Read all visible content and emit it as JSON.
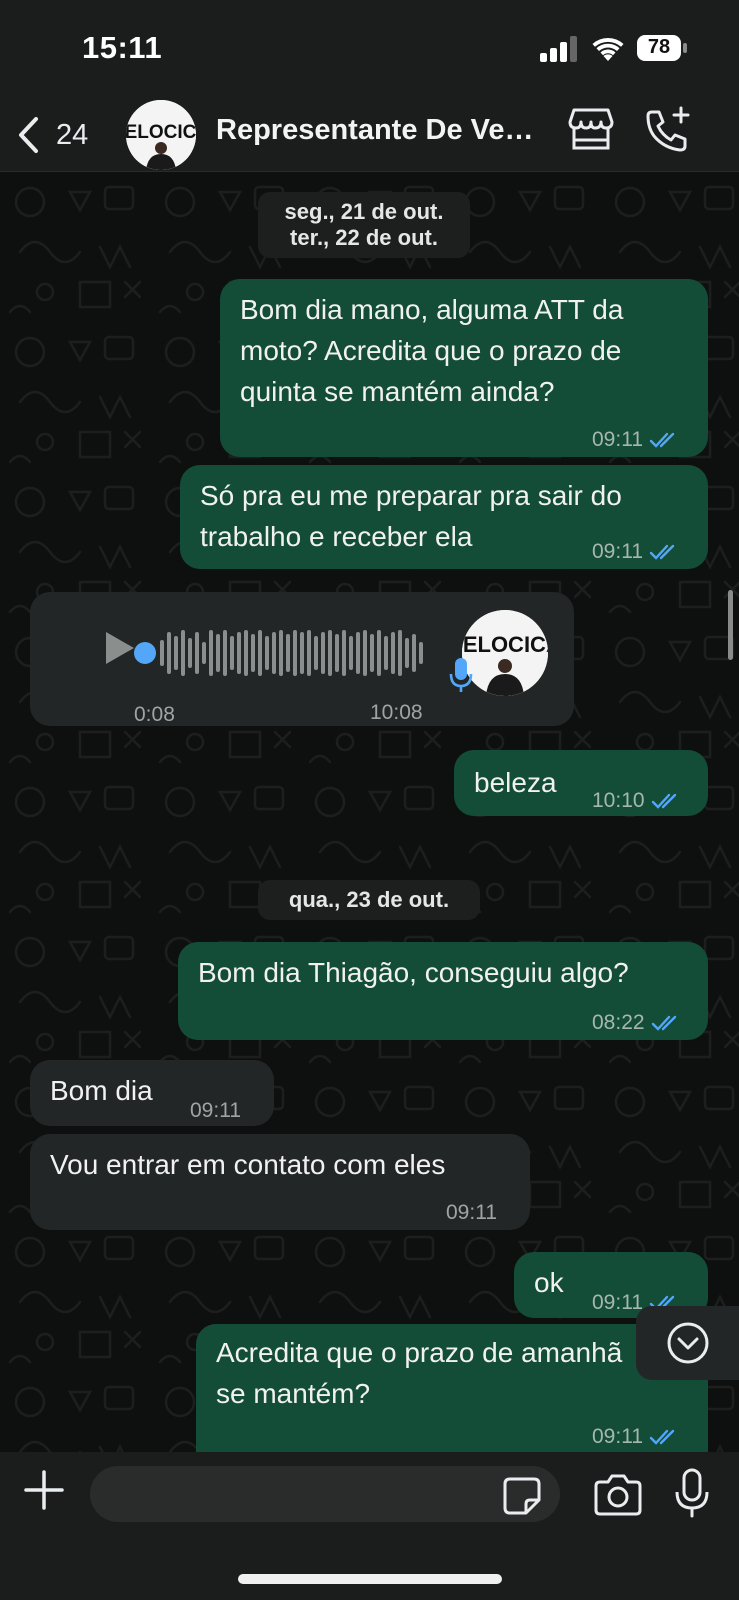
{
  "status_bar": {
    "time": "15:11",
    "battery": "78"
  },
  "header": {
    "back_count": "24",
    "contact_name": "Representante De Vendas - Velocicar",
    "avatar_text": "VELOCICA"
  },
  "dates": {
    "d1": "seg., 21 de out.",
    "d2": "ter., 22 de out.",
    "d3": "qua., 23 de out."
  },
  "messages": [
    {
      "dir": "out",
      "lines": [
        "Bom dia mano, alguma ATT da",
        "moto? Acredita que o prazo de",
        "quinta se mantém ainda?"
      ],
      "time": "09:11",
      "read": true
    },
    {
      "dir": "out",
      "lines": [
        "Só pra eu me preparar pra sair do",
        "trabalho e receber ela"
      ],
      "time": "09:11",
      "read": true
    },
    {
      "dir": "in",
      "type": "voice",
      "duration": "0:08",
      "time": "10:08"
    },
    {
      "dir": "out",
      "lines": [
        "beleza"
      ],
      "time": "10:10",
      "read": true
    },
    {
      "dir": "out",
      "lines": [
        "Bom dia Thiagão, conseguiu algo?"
      ],
      "time": "08:22",
      "read": true
    },
    {
      "dir": "in",
      "lines": [
        "Bom dia"
      ],
      "time": "09:11"
    },
    {
      "dir": "in",
      "lines": [
        "Vou entrar em contato com eles"
      ],
      "time": "09:11"
    },
    {
      "dir": "out",
      "lines": [
        "ok"
      ],
      "time": "09:11",
      "read": true
    },
    {
      "dir": "out",
      "lines": [
        "Acredita que o prazo de amanhã",
        "se mantém?"
      ],
      "time": "09:11",
      "read": true
    }
  ],
  "composer": {
    "placeholder": ""
  },
  "colors": {
    "outgoing": "#134d37",
    "incoming": "#232626",
    "tick_read": "#53a6f8",
    "accent": "#25d366"
  }
}
